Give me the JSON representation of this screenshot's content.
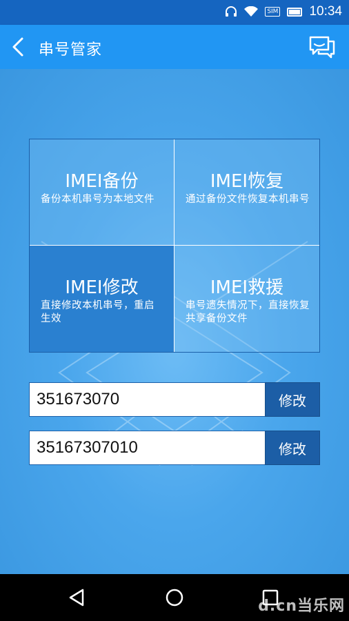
{
  "status_bar": {
    "time": "10:34",
    "sim_label": "SIM",
    "icons": [
      "headset-icon",
      "wifi-icon",
      "sim-icon",
      "battery-icon"
    ]
  },
  "app_bar": {
    "title": "串号管家",
    "back_icon": "chevron-left-icon",
    "action_icon": "chat-bubbles-icon"
  },
  "tiles": [
    {
      "title": "IMEI备份",
      "desc": "备份本机串号为本地文件"
    },
    {
      "title": "IMEI恢复",
      "desc": "通过备份文件恢复本机串号"
    },
    {
      "title": "IMEI修改",
      "desc": "直接修改本机串号，重启生效"
    },
    {
      "title": "IMEI救援",
      "desc": "串号遗失情况下，直接恢复共享备份文件"
    }
  ],
  "rows": [
    {
      "value": "351673070",
      "button": "修改"
    },
    {
      "value": "35167307010",
      "button": "修改"
    }
  ],
  "watermark": "d.cn当乐网",
  "colors": {
    "status_bar": "#1565c0",
    "app_bar": "#2196f3",
    "background": "#3a9be6",
    "selected_tile": "#2a80d0",
    "button": "#1c5ea6"
  }
}
